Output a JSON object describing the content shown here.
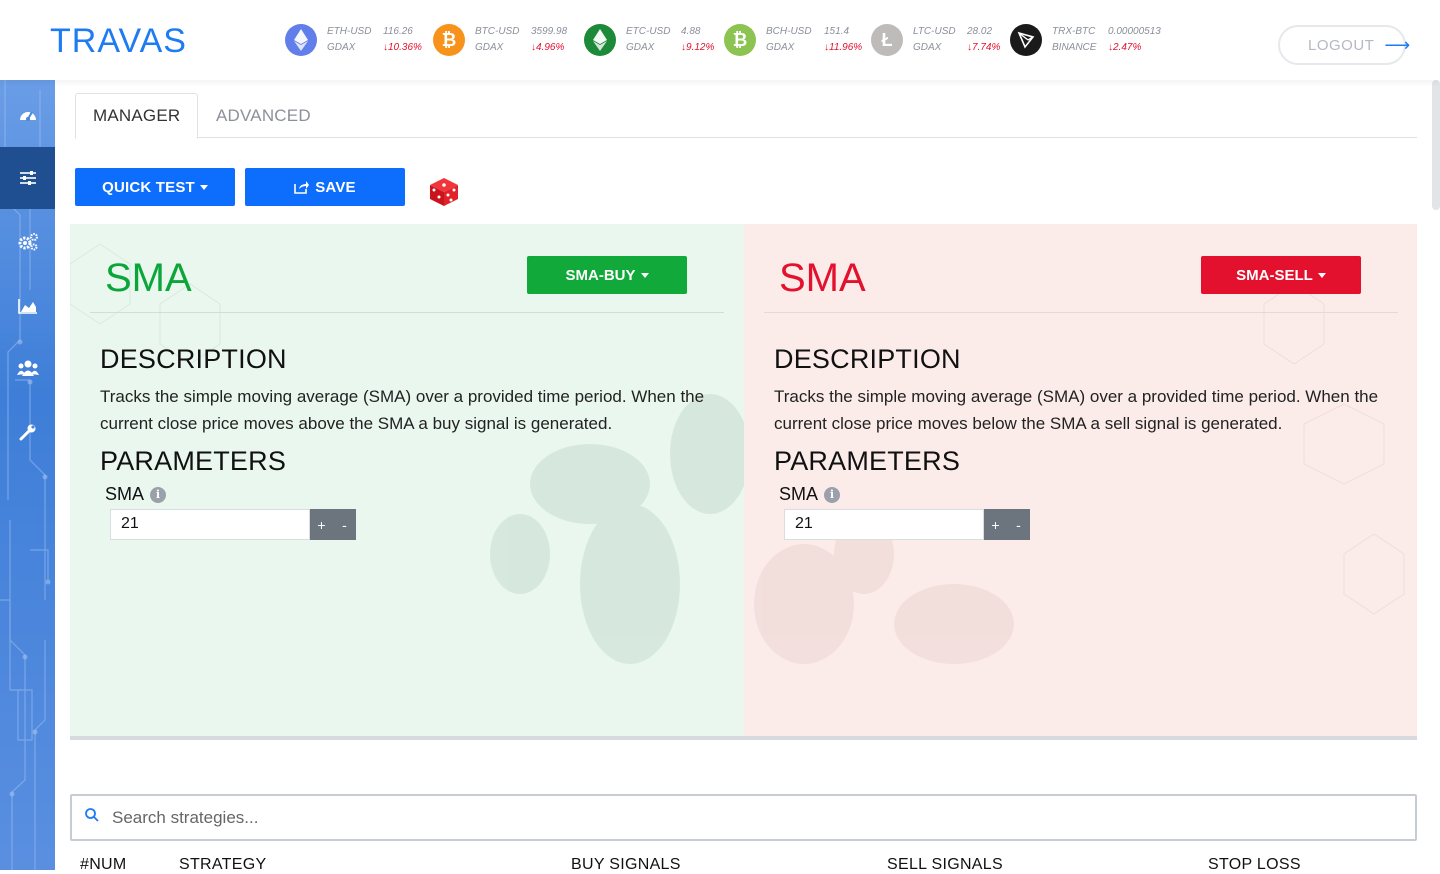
{
  "app": {
    "logo": "TRAVAS",
    "logout_label": "LOGOUT"
  },
  "tickers": [
    {
      "pair": "ETH-USD",
      "price": "116.26",
      "exchange": "GDAX",
      "change": "↓10.36%",
      "icon": "ethereum-icon",
      "color": "#627eea"
    },
    {
      "pair": "BTC-USD",
      "price": "3599.98",
      "exchange": "GDAX",
      "change": "↓4.96%",
      "icon": "bitcoin-icon",
      "color": "#f7931a"
    },
    {
      "pair": "ETC-USD",
      "price": "4.88",
      "exchange": "GDAX",
      "change": "↓9.12%",
      "icon": "ethereum-classic-icon",
      "color": "#1d8a3a"
    },
    {
      "pair": "BCH-USD",
      "price": "151.4",
      "exchange": "GDAX",
      "change": "↓11.96%",
      "icon": "bitcoin-cash-icon",
      "color": "#8dc351"
    },
    {
      "pair": "LTC-USD",
      "price": "28.02",
      "exchange": "GDAX",
      "change": "↓7.74%",
      "icon": "litecoin-icon",
      "color": "#bfbbbb"
    },
    {
      "pair": "TRX-BTC",
      "price": "0.00000513",
      "exchange": "BINANCE",
      "change": "↓2.47%",
      "icon": "tron-icon",
      "color": "#1a1a1a"
    }
  ],
  "sidebar": {
    "items": [
      {
        "icon": "dashboard-icon",
        "active": false
      },
      {
        "icon": "sliders-icon",
        "active": true
      },
      {
        "icon": "gears-icon",
        "active": false
      },
      {
        "icon": "area-chart-icon",
        "active": false
      },
      {
        "icon": "users-icon",
        "active": false
      },
      {
        "icon": "wrench-icon",
        "active": false
      }
    ]
  },
  "tabs": [
    {
      "label": "MANAGER",
      "active": true
    },
    {
      "label": "ADVANCED",
      "active": false
    }
  ],
  "toolbar": {
    "quick_test_label": "QUICK TEST",
    "save_label": "SAVE"
  },
  "buy_panel": {
    "title": "SMA",
    "dropdown_label": "SMA-BUY",
    "description_heading": "DESCRIPTION",
    "description": "Tracks the simple moving average (SMA) over a provided time period. When the current close price moves above the SMA a buy signal is generated.",
    "parameters_heading": "PARAMETERS",
    "param_label": "SMA",
    "param_value": "21",
    "plus": "+",
    "minus": "-"
  },
  "sell_panel": {
    "title": "SMA",
    "dropdown_label": "SMA-SELL",
    "description_heading": "DESCRIPTION",
    "description": "Tracks the simple moving average (SMA) over a provided time period. When the current close price moves below the SMA a sell signal is generated.",
    "parameters_heading": "PARAMETERS",
    "param_label": "SMA",
    "param_value": "21",
    "plus": "+",
    "minus": "-"
  },
  "search": {
    "placeholder": "Search strategies..."
  },
  "table": {
    "columns": [
      "#NUM",
      "STRATEGY",
      "BUY SIGNALS",
      "SELL SIGNALS",
      "STOP LOSS"
    ]
  },
  "colors": {
    "accent": "#0d6efd",
    "buy": "#10a93a",
    "sell": "#e3112d"
  }
}
